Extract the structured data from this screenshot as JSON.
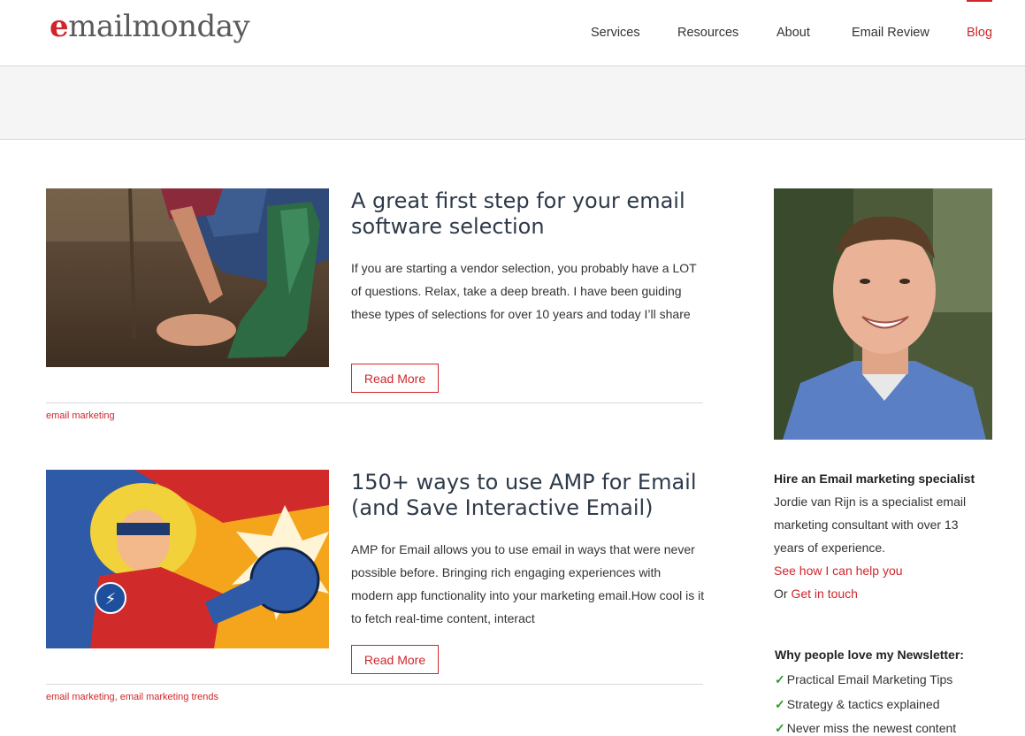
{
  "header": {
    "logo_e": "e",
    "logo_rest": "mailmonday",
    "nav": [
      "Services",
      "Resources",
      "About",
      "Email Review",
      "Blog"
    ],
    "active_nav": "Blog",
    "accent": "#d0262b"
  },
  "posts": [
    {
      "title": "A great first step for your email software selection",
      "excerpt": "If you are starting a vendor selection, you probably have a LOT of questions. Relax, take a deep breath. I have been guiding these types of selections for over 10 years and today I’ll share",
      "read_more": "Read More",
      "categories": [
        "email marketing"
      ]
    },
    {
      "title": "150+ ways to use AMP for Email (and Save Interactive Email)",
      "excerpt": "AMP for Email allows you to use email in ways that were never possible before. Bringing  rich engaging experiences with modern app functionality into your marketing email.How cool is it to fetch real-time content, interact",
      "read_more": "Read More",
      "categories": [
        "email marketing",
        "email marketing trends"
      ],
      "category_separator": ", "
    }
  ],
  "sidebar": {
    "hire_heading": "Hire an Email marketing specialist",
    "bio": "Jordie van Rijn is a specialist email marketing consultant with over 13 years of experience.",
    "help_link": "See how I can help you",
    "or_text": "Or ",
    "contact_link": "Get in touch",
    "newsletter_heading": "Why people love my Newsletter:",
    "newsletter_items": [
      "Practical Email Marketing Tips",
      "Strategy & tactics explained",
      "Never miss the newest content"
    ],
    "check_icon": "check-icon"
  }
}
